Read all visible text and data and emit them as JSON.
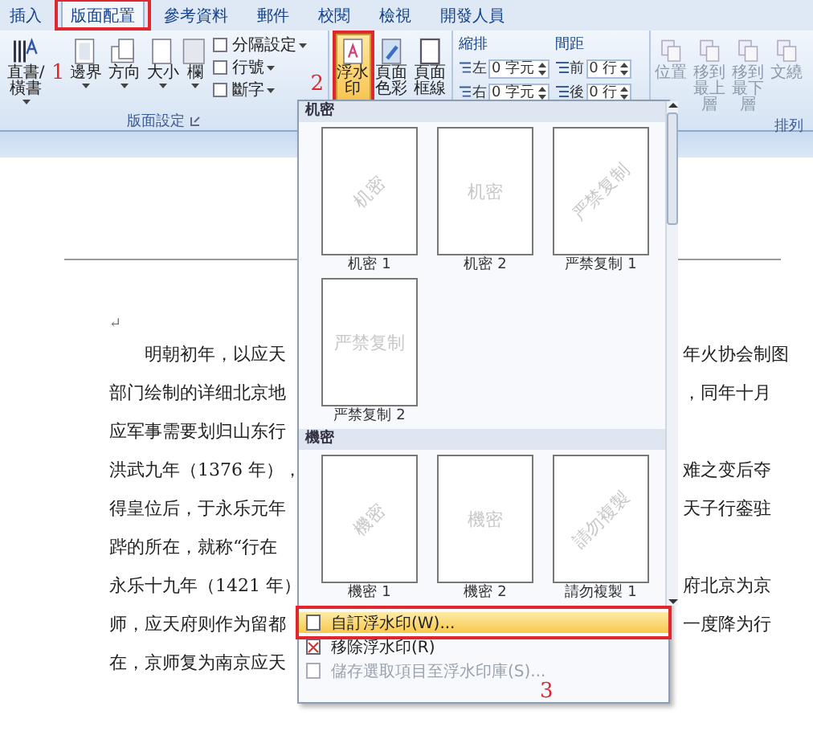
{
  "tabs": [
    {
      "label": "插入",
      "selected": false
    },
    {
      "label": "版面配置",
      "selected": true
    },
    {
      "label": "參考資料",
      "selected": false
    },
    {
      "label": "郵件",
      "selected": false
    },
    {
      "label": "校閱",
      "selected": false
    },
    {
      "label": "檢視",
      "selected": false
    },
    {
      "label": "開發人員",
      "selected": false
    }
  ],
  "page_setup_group": {
    "label": "版面設定",
    "big_buttons": [
      {
        "label": "直書/橫書",
        "kind": "direction"
      },
      {
        "label": "邊界",
        "kind": "margins"
      },
      {
        "label": "方向",
        "kind": "orientation"
      },
      {
        "label": "大小",
        "kind": "size"
      },
      {
        "label": "欄",
        "kind": "columns"
      }
    ],
    "small_buttons": [
      {
        "label": "分隔設定"
      },
      {
        "label": "行號"
      },
      {
        "label": "斷字"
      }
    ]
  },
  "page_background_group": {
    "buttons": [
      {
        "label": "浮水印",
        "kind": "watermark",
        "selected": true
      },
      {
        "label": "頁面色彩",
        "kind": "color",
        "selected": false
      },
      {
        "label": "頁面框線",
        "kind": "border",
        "selected": false
      }
    ]
  },
  "paragraph_group": {
    "columns": [
      {
        "title": "縮排",
        "fields": [
          {
            "label": "左",
            "value": "0 字元"
          },
          {
            "label": "右",
            "value": "0 字元"
          }
        ]
      },
      {
        "title": "間距",
        "fields": [
          {
            "label": "前",
            "value": "0 行"
          },
          {
            "label": "後",
            "value": "0 行"
          }
        ]
      }
    ]
  },
  "arrange_group": {
    "label": "排列",
    "buttons": [
      {
        "label": "位置"
      },
      {
        "label": "移到最上層"
      },
      {
        "label": "移到最下層"
      },
      {
        "label": "文繞"
      }
    ]
  },
  "annotation_marks": [
    "1",
    "2",
    "3"
  ],
  "document": {
    "paragraph_mark": "↵",
    "lines": [
      {
        "left": "明朝初年，以应天",
        "right": "年火协会制图"
      },
      {
        "left": "部门绘制的详细北京地",
        "right": "，同年十月"
      },
      {
        "left": "应军事需要划归山东行"
      },
      {
        "left": "洪武九年（1376 年），",
        "right": "难之变后夺"
      },
      {
        "left": "得皇位后，于永乐元年",
        "right": "天子行銮驻"
      },
      {
        "left": "跸的所在，就称“行在"
      },
      {
        "left": "永乐十九年（1421 年）",
        "right": "府北京为京"
      },
      {
        "left": "师，应天府则作为留都",
        "right": "一度降为行"
      },
      {
        "left": "在，京师复为南京应天"
      }
    ]
  },
  "watermark_menu": {
    "sections": [
      {
        "title": "机密",
        "items": [
          {
            "label": "机密 1",
            "watermark": "机密",
            "kind": "diagonal"
          },
          {
            "label": "机密 2",
            "watermark": "机密",
            "kind": "horizontal"
          },
          {
            "label": "严禁复制 1",
            "watermark": "严禁复制",
            "kind": "diagonal"
          },
          {
            "label": "严禁复制 2",
            "watermark": "严禁复制",
            "kind": "horizontal"
          }
        ]
      },
      {
        "title": "機密",
        "items": [
          {
            "label": "機密 1",
            "watermark": "機密",
            "kind": "diagonal"
          },
          {
            "label": "機密 2",
            "watermark": "機密",
            "kind": "horizontal"
          },
          {
            "label": "請勿複製 1",
            "watermark": "請勿複製",
            "kind": "diagonal"
          }
        ]
      }
    ],
    "commands": [
      {
        "label": "自訂浮水印(W)...",
        "selected": true,
        "disabled": false
      },
      {
        "label": "移除浮水印(R)",
        "selected": false,
        "disabled": false
      },
      {
        "label": "儲存選取項目至浮水印庫(S)...",
        "selected": false,
        "disabled": true
      }
    ]
  }
}
